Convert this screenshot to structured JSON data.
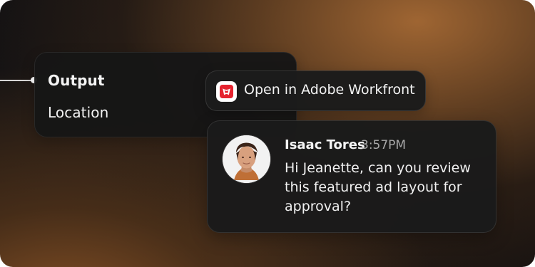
{
  "node": {
    "output_label": "Output",
    "location_label": "Location"
  },
  "action": {
    "label": "Open in Adobe Workfront",
    "icon": "adobe-workfront-icon",
    "accent": "#e5232f"
  },
  "message": {
    "sender": "Isaac Tores",
    "time": "3:57PM",
    "text": "Hi Jeanette, can you review this featured ad layout for approval?",
    "avatar_icon": "user-avatar"
  },
  "colors": {
    "background_dark": "#1b1715",
    "background_warm": "#8b5a2b",
    "card": "#1b1b1b",
    "text": "#f3f3f3",
    "muted_text": "#a8a8a8"
  }
}
